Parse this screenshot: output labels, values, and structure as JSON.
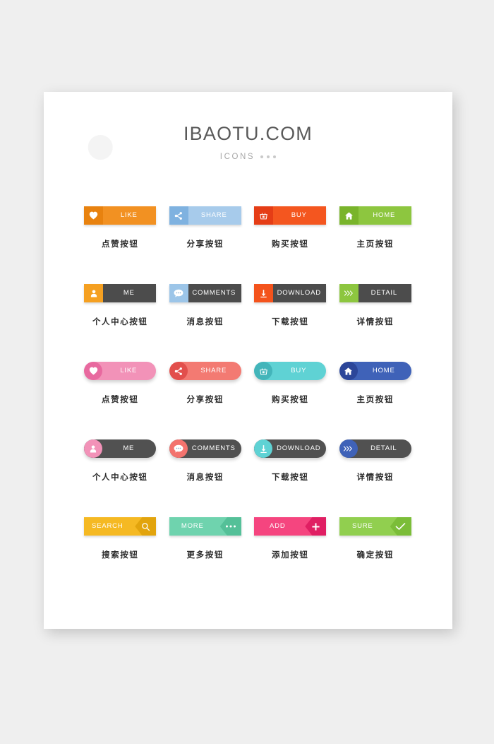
{
  "header": {
    "brand": "IBAOTU.COM",
    "subtitle": "ICONS"
  },
  "colors": {
    "orange": "#f29122",
    "orange_dark": "#e07c10",
    "blue_light": "#9cc5e8",
    "blue_light_dark": "#6aa9dc",
    "red_orange": "#f55a23",
    "red_orange_dark": "#e03e16",
    "green": "#8dc63f",
    "green_dark": "#76b52a",
    "gray_dark": "#4a4a4a",
    "gray_darker": "#3d3d3d",
    "pink": "#f08cb4",
    "pink_dark": "#e06a9d",
    "coral": "#f0736e",
    "coral_dark": "#e0524f",
    "teal": "#5fcfd0",
    "teal_dark": "#46b7bb",
    "blue": "#3d5fb5",
    "blue_dark": "#2e4a9e",
    "gray_pill": "#4f4f4f",
    "yellow": "#f5b923",
    "yellow_dark": "#e0a310",
    "mint": "#6fd3ae",
    "mint_dark": "#55bf98",
    "hot_pink": "#f5457f",
    "hot_pink_dark": "#e01f63",
    "lime": "#91cf4f",
    "lime_dark": "#7bbd38"
  },
  "rows": [
    {
      "style": "flat",
      "buttons": [
        {
          "label": "LIKE",
          "caption": "点赞按钮",
          "icon": "heart-icon",
          "body": "#f29122",
          "icon_bg": "#e8820f",
          "name": "like-button"
        },
        {
          "label": "SHARE",
          "caption": "分享按钮",
          "icon": "share-icon",
          "body": "#a7cbeb",
          "icon_bg": "#7fb2e0",
          "name": "share-button"
        },
        {
          "label": "BUY",
          "caption": "购买按钮",
          "icon": "basket-icon",
          "body": "#f4561f",
          "icon_bg": "#e53d16",
          "name": "buy-button"
        },
        {
          "label": "HOME",
          "caption": "主页按钮",
          "icon": "home-icon",
          "body": "#8dc63f",
          "icon_bg": "#79b42b",
          "name": "home-button"
        }
      ]
    },
    {
      "style": "flat",
      "buttons": [
        {
          "label": "ME",
          "caption": "个人中心按钮",
          "icon": "user-icon",
          "body": "#4c4c4c",
          "icon_bg": "#f5a021",
          "name": "me-button"
        },
        {
          "label": "COMMENTS",
          "caption": "消息按钮",
          "icon": "comment-icon",
          "body": "#4c4c4c",
          "icon_bg": "#9cc5e8",
          "name": "comments-button"
        },
        {
          "label": "DOWNLOAD",
          "caption": "下载按钮",
          "icon": "download-icon",
          "body": "#4c4c4c",
          "icon_bg": "#f4531c",
          "name": "download-button"
        },
        {
          "label": "DETAIL",
          "caption": "详情按钮",
          "icon": "chevrons-icon",
          "body": "#4c4c4c",
          "icon_bg": "#8dc63f",
          "name": "detail-button"
        }
      ]
    },
    {
      "style": "pill",
      "buttons": [
        {
          "label": "LIKE",
          "caption": "点赞按钮",
          "icon": "heart-icon",
          "body": "#f292b8",
          "icon_bg": "#e8699f",
          "name": "like-button-round"
        },
        {
          "label": "SHARE",
          "caption": "分享按钮",
          "icon": "share-icon",
          "body": "#f37a72",
          "icon_bg": "#e24f4c",
          "name": "share-button-round"
        },
        {
          "label": "BUY",
          "caption": "购买按钮",
          "icon": "basket-icon",
          "body": "#5fd2d4",
          "icon_bg": "#43b5ba",
          "name": "buy-button-round"
        },
        {
          "label": "HOME",
          "caption": "主页按钮",
          "icon": "home-icon",
          "body": "#3f62b8",
          "icon_bg": "#2c4699",
          "name": "home-button-round"
        }
      ]
    },
    {
      "style": "pill",
      "buttons": [
        {
          "label": "ME",
          "caption": "个人中心按钮",
          "icon": "user-icon",
          "body": "#515151",
          "icon_bg": "#f292b8",
          "name": "me-button-round"
        },
        {
          "label": "COMMENTS",
          "caption": "消息按钮",
          "icon": "comment-icon",
          "body": "#515151",
          "icon_bg": "#f3736e",
          "name": "comments-button-round"
        },
        {
          "label": "DOWNLOAD",
          "caption": "下载按钮",
          "icon": "download-icon",
          "body": "#515151",
          "icon_bg": "#5fd2d4",
          "name": "download-button-round"
        },
        {
          "label": "DETAIL",
          "caption": "详情按钮",
          "icon": "chevrons-icon",
          "body": "#515151",
          "icon_bg": "#3f62b8",
          "name": "detail-button-round"
        }
      ]
    },
    {
      "style": "arrow",
      "buttons": [
        {
          "label": "SEARCH",
          "caption": "搜索按钮",
          "icon": "search-icon",
          "body": "#f5b923",
          "icon_bg": "#e2a40d",
          "name": "search-button"
        },
        {
          "label": "MORE",
          "caption": "更多按钮",
          "icon": "ellipsis-icon",
          "body": "#6fd3ae",
          "icon_bg": "#54c098",
          "name": "more-button"
        },
        {
          "label": "ADD",
          "caption": "添加按钮",
          "icon": "plus-icon",
          "body": "#f5457f",
          "icon_bg": "#e01f63",
          "name": "add-button"
        },
        {
          "label": "SURE",
          "caption": "确定按钮",
          "icon": "check-icon",
          "body": "#91cf4f",
          "icon_bg": "#7bbd38",
          "name": "sure-button"
        }
      ]
    }
  ]
}
